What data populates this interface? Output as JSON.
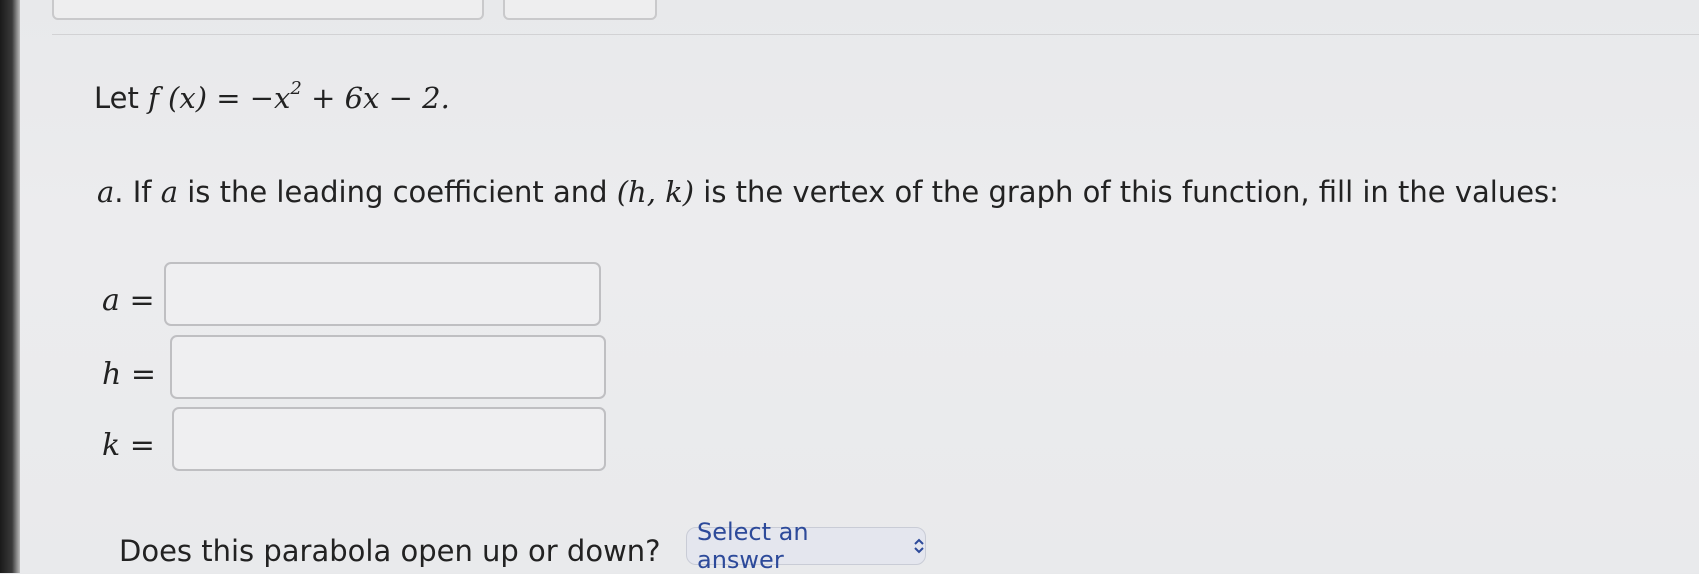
{
  "question": {
    "line1": {
      "prefix": "Let",
      "fx": "f (x) = −x",
      "exp": "2",
      "rest": "+ 6x − 2."
    },
    "partA": {
      "marker": "a",
      "t1": ". If",
      "a": "a",
      "t2": "is the leading coefficient and",
      "hk": "(h, k)",
      "t3": "is the vertex of the graph of this function, fill in the values:"
    },
    "fields": [
      {
        "var": "a",
        "eq": "=",
        "value": ""
      },
      {
        "var": "h",
        "eq": "=",
        "value": ""
      },
      {
        "var": "k",
        "eq": "=",
        "value": ""
      }
    ],
    "partB": {
      "text": "Does this parabola open up or down?",
      "select_label": "Select an answer"
    }
  }
}
